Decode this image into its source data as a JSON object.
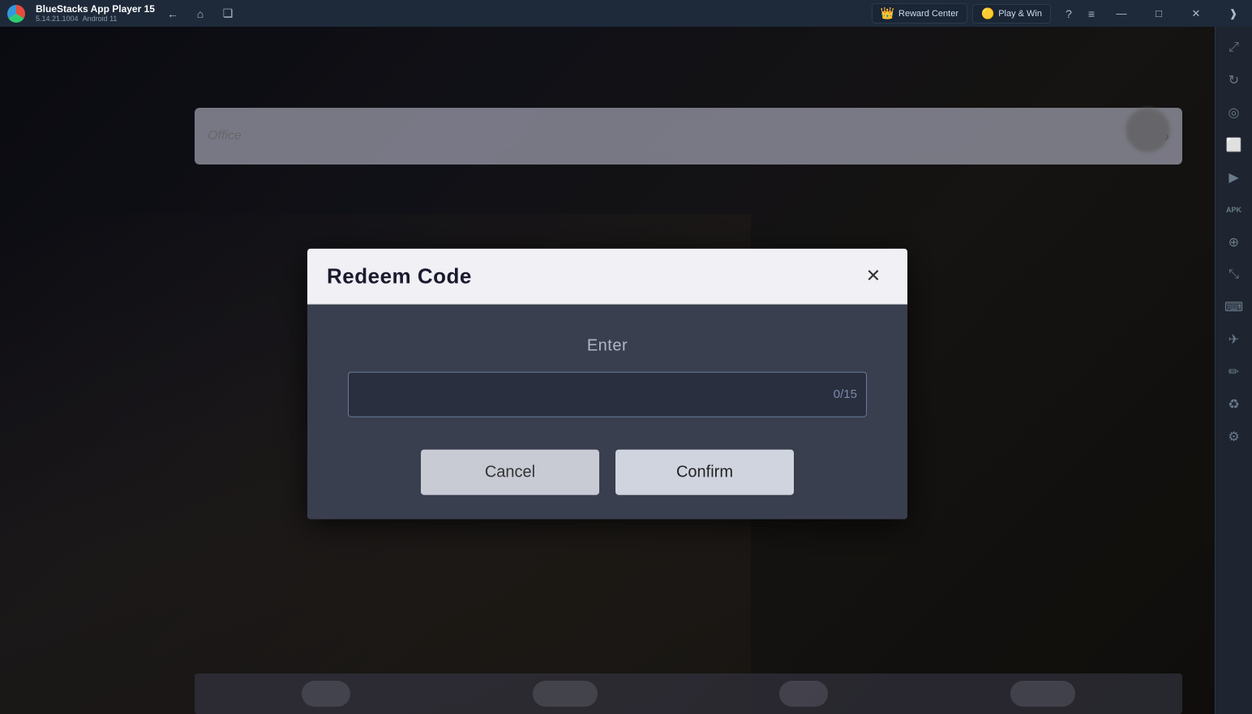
{
  "app": {
    "name": "BlueStacks App Player 15",
    "version": "5.14.21.1004",
    "os": "Android 11"
  },
  "titlebar": {
    "back_label": "←",
    "home_label": "⌂",
    "copy_label": "❐",
    "reward_center_label": "Reward Center",
    "play_win_label": "Play & Win",
    "help_label": "?",
    "menu_label": "≡",
    "minimize_label": "—",
    "maximize_label": "□",
    "close_label": "✕",
    "restore_label": "❐"
  },
  "sidebar": {
    "icons": [
      {
        "name": "expand-icon",
        "symbol": "⤢"
      },
      {
        "name": "rotate-icon",
        "symbol": "↻"
      },
      {
        "name": "volume-icon",
        "symbol": "◉"
      },
      {
        "name": "screenshot-icon",
        "symbol": "📷"
      },
      {
        "name": "camera-icon",
        "symbol": "⏯"
      },
      {
        "name": "apk-icon",
        "symbol": "APK"
      },
      {
        "name": "settings2-icon",
        "symbol": "⊕"
      },
      {
        "name": "resize-icon",
        "symbol": "⤡"
      },
      {
        "name": "keyboard-icon",
        "symbol": "⌨"
      },
      {
        "name": "location-icon",
        "symbol": "✈"
      },
      {
        "name": "brush-icon",
        "symbol": "✏"
      },
      {
        "name": "eco-icon",
        "symbol": "♻"
      },
      {
        "name": "settings-icon",
        "symbol": "⚙"
      }
    ]
  },
  "dialog": {
    "title": "Redeem Code",
    "close_label": "✕",
    "enter_label": "Enter",
    "input_placeholder": "",
    "input_counter": "0/15",
    "cancel_label": "Cancel",
    "confirm_label": "Confirm"
  }
}
